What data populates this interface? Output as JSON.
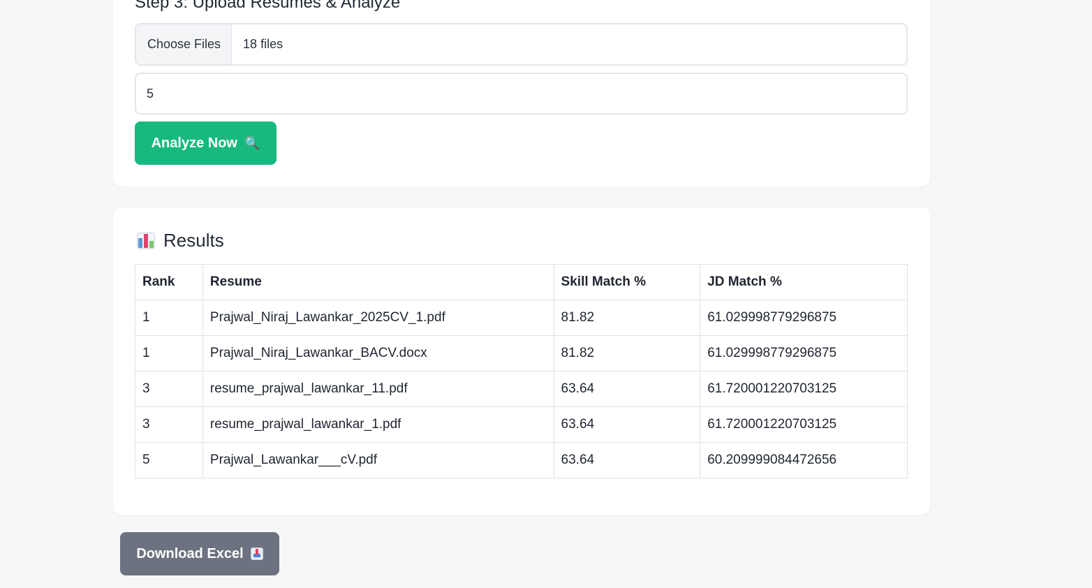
{
  "upload": {
    "title": "Step 3: Upload Resumes & Analyze",
    "choose_files_label": "Choose Files",
    "file_count": "18 files",
    "top_n_value": "5",
    "analyze_label": "Analyze Now",
    "analyze_icon": "magnifier-icon"
  },
  "results": {
    "title": "Results",
    "title_icon": "bar-chart-icon",
    "headers": [
      "Rank",
      "Resume",
      "Skill Match %",
      "JD Match %"
    ],
    "rows": [
      [
        "1",
        "Prajwal_Niraj_Lawankar_2025CV_1.pdf",
        "81.82",
        "61.029998779296875"
      ],
      [
        "1",
        "Prajwal_Niraj_Lawankar_BACV.docx",
        "81.82",
        "61.029998779296875"
      ],
      [
        "3",
        "resume_prajwal_lawankar_11.pdf",
        "63.64",
        "61.720001220703125"
      ],
      [
        "3",
        "resume_prajwal_lawankar_1.pdf",
        "63.64",
        "61.720001220703125"
      ],
      [
        "5",
        "Prajwal_Lawankar___cV.pdf",
        "63.64",
        "60.209999084472656"
      ]
    ]
  },
  "download": {
    "label": "Download Excel",
    "icon": "inbox-tray-icon"
  },
  "colors": {
    "analyze_button": "#17b97f",
    "download_button": "#6c727f",
    "page_background": "#f6f7f9"
  }
}
